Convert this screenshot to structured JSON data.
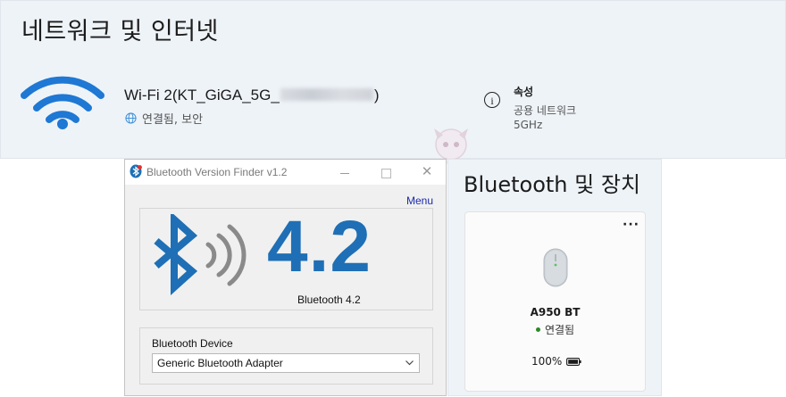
{
  "network_panel": {
    "title": "네트워크 및 인터넷",
    "wifi_name_prefix": "Wi-Fi 2(KT_GiGA_5G_",
    "wifi_name_suffix": ")",
    "wifi_status": "연결됨, 보안",
    "properties_title": "속성",
    "properties_network_type": "공용 네트워크",
    "properties_band": "5GHz",
    "accent_color": "#1e78d4"
  },
  "bt_finder": {
    "window_title": "Bluetooth Version Finder v1.2",
    "menu_label": "Menu",
    "version_number": "4.2",
    "version_label": "Bluetooth 4.2",
    "device_label": "Bluetooth Device",
    "selected_device": "Generic Bluetooth Adapter",
    "brand_color": "#1e6fb5"
  },
  "bt_panel": {
    "title": "Bluetooth 및 장치",
    "more_label": "···",
    "device_name": "A950 BT",
    "device_status": "연결됨",
    "battery": "100%",
    "status_color": "#2a8a2a"
  },
  "icons": [
    "wifi-icon",
    "globe-icon",
    "info-icon",
    "bluetooth-icon",
    "signal-waves-icon",
    "close-icon",
    "minimize-icon",
    "maximize-icon",
    "chevron-down-icon",
    "mouse-icon",
    "battery-icon",
    "more-icon"
  ]
}
